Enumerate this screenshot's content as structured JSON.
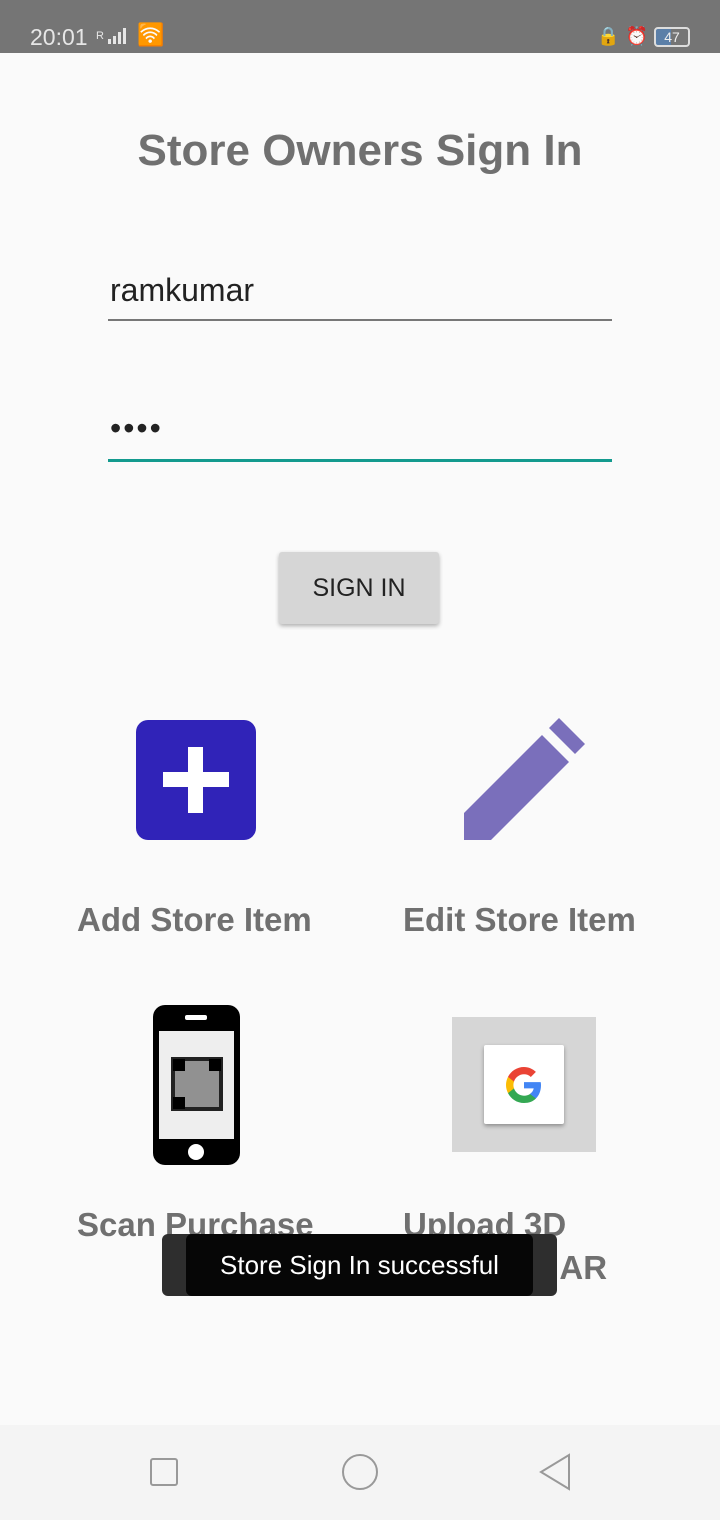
{
  "status_bar": {
    "time": "20:01",
    "roaming": "R",
    "battery": "47"
  },
  "title": "Store Owners Sign In",
  "username": {
    "value": "ramkumar"
  },
  "password": {
    "value": "••••"
  },
  "sign_in_label": "SIGN IN",
  "actions": [
    {
      "label": "Add Store Item",
      "icon": "plus-icon",
      "color": "#3023b8"
    },
    {
      "label": "Edit Store Item",
      "icon": "pencil-icon",
      "color": "#7a6fbb"
    },
    {
      "label": "Scan Purchase",
      "icon": "phone-qr-icon"
    },
    {
      "label": "Upload 3D Model for AR",
      "icon": "google-icon"
    }
  ],
  "toast": "Store Sign In successful",
  "accent": "#139a8e"
}
